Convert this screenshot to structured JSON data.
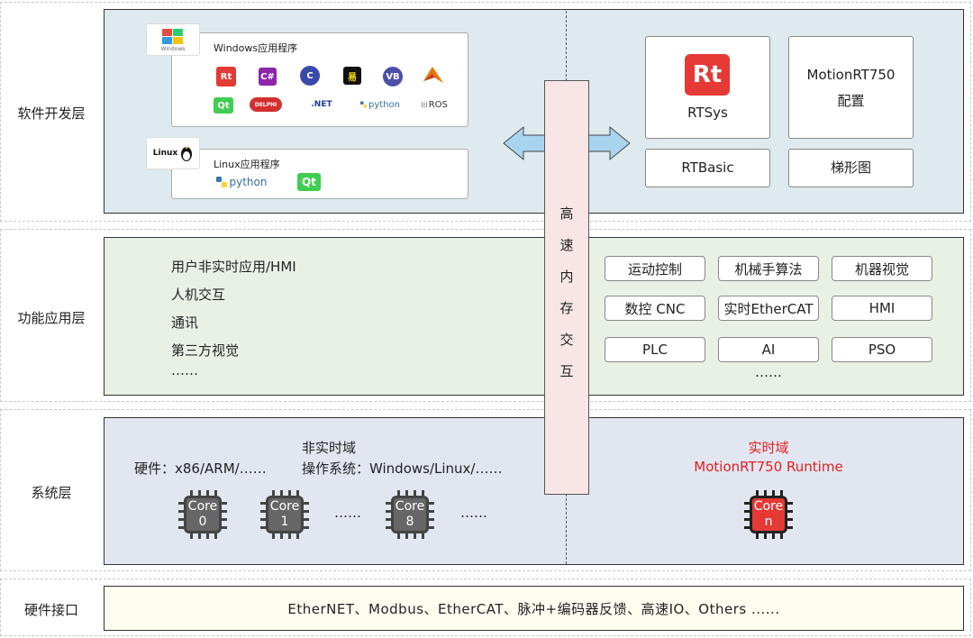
{
  "layers": {
    "software": "软件开发层",
    "function": "功能应用层",
    "system": "系统层",
    "hardware": "硬件接口"
  },
  "software": {
    "windows_box_title": "Windows应用程序",
    "windows_logo_text": "Windows",
    "windows_langs": [
      "Rt",
      "C#",
      "C",
      "易",
      "VB",
      "ML"
    ],
    "windows_langs2": [
      "Qt",
      "DELPHI",
      ".NET",
      "python",
      "ROS"
    ],
    "linux_box_title": "Linux应用程序",
    "linux_logo_text": "Linux",
    "linux_langs": [
      "python",
      "Qt"
    ],
    "rtsys_label": "RTSys",
    "rtsys_logo": "Rt",
    "motion_config_line1": "MotionRT750",
    "motion_config_line2": "配置",
    "rtbasic_label": "RTBasic",
    "ladder_label": "梯形图"
  },
  "memory_exchange": [
    "高",
    "速",
    "内",
    "存",
    "交",
    "互"
  ],
  "function": {
    "left_items": [
      "用户非实时应用/HMI",
      "人机交互",
      "通讯",
      "第三方视觉",
      "……"
    ],
    "right_grid": [
      [
        "运动控制",
        "机械手算法",
        "机器视觉"
      ],
      [
        "数控 CNC",
        "实时EtherCAT",
        "HMI"
      ],
      [
        "PLC",
        "AI",
        "PSO"
      ]
    ],
    "right_more": "……"
  },
  "system": {
    "non_rt_title": "非实时域",
    "hardware_line": "硬件：x86/ARM/……",
    "os_line": "操作系统：Windows/Linux/……",
    "cores": [
      {
        "top": "Core",
        "bottom": "0"
      },
      {
        "top": "Core",
        "bottom": "1"
      },
      {
        "top": "Core",
        "bottom": "8"
      }
    ],
    "dots1": "……",
    "dots2": "……",
    "rt_title": "实时域",
    "rt_subtitle": "MotionRT750 Runtime",
    "rt_core": {
      "top": "Core",
      "bottom": "n"
    },
    "rt_color": "#e02020"
  },
  "hardware": {
    "interfaces": "EtherNET、Modbus、EtherCAT、脉冲+编码器反馈、高速IO、Others ......"
  },
  "colors": {
    "software_bg": "#dfeaef",
    "function_bg": "#e9f1e7",
    "system_bg": "#e2e6f1",
    "hardware_bg": "#fffdf0",
    "arrow": "#a9d4ee",
    "memory": "#f8e6e6",
    "accent_red": "#e02020"
  }
}
